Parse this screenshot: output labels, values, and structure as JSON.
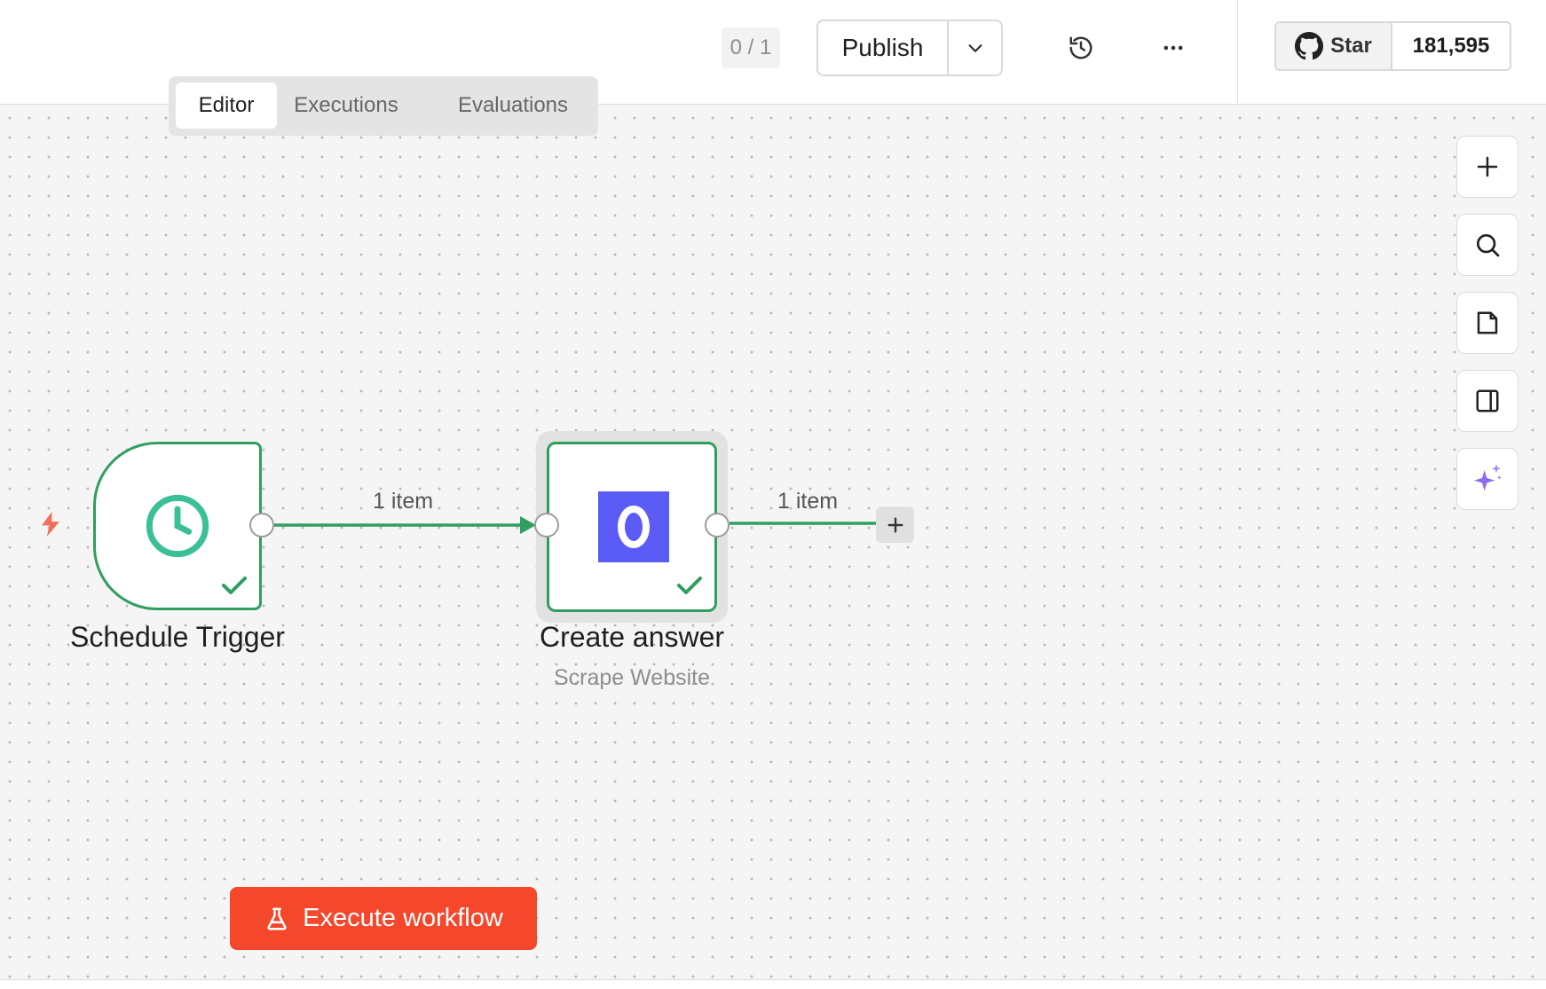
{
  "header": {
    "counter": "0 / 1",
    "publish_label": "Publish",
    "github": {
      "star_label": "Star",
      "star_count": "181,595"
    },
    "icons": [
      "chevron-down-icon",
      "history-icon",
      "more-horizontal-icon",
      "github-icon"
    ]
  },
  "tabs": [
    {
      "label": "Editor",
      "active": true
    },
    {
      "label": "Executions",
      "active": false
    },
    {
      "label": "Evaluations",
      "active": false
    }
  ],
  "canvas": {
    "nodes": [
      {
        "label": "Schedule Trigger",
        "icon": "clock-icon",
        "status": "success"
      },
      {
        "label": "Create answer",
        "subtitle": "Scrape Website",
        "icon": "openai-logo",
        "status": "success"
      }
    ],
    "edges": [
      {
        "label": "1 item"
      },
      {
        "label": "1 item"
      }
    ],
    "side_tools": [
      "plus-icon",
      "search-icon",
      "sticky-note-icon",
      "panel-icon",
      "sparkles-icon"
    ]
  },
  "execute_button": {
    "label": "Execute workflow",
    "icon": "flask-icon"
  },
  "colors": {
    "success": "#2f9e5f",
    "accent": "#f4472b",
    "trigger_icon": "#ef6f5a",
    "clock": "#3bbf97",
    "logo_bg": "#5b5bf5",
    "ai": "#8b6cf2"
  }
}
